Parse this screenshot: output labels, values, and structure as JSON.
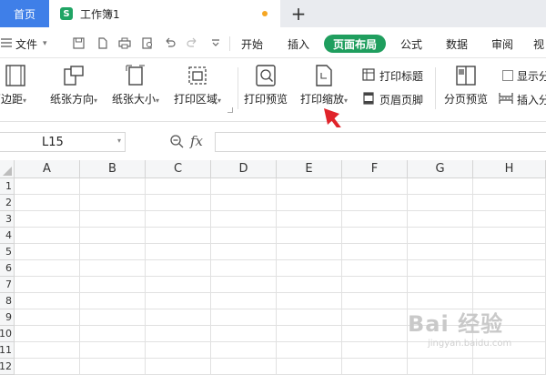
{
  "tabs": {
    "home": "首页",
    "document": "工作簿1",
    "new_tab": "+"
  },
  "menu": {
    "file": "文件",
    "items": [
      "开始",
      "插入",
      "页面布局",
      "公式",
      "数据",
      "审阅",
      "视"
    ],
    "active": "页面布局"
  },
  "ribbon": {
    "margins": "页边距",
    "orientation": "纸张方向",
    "paper_size": "纸张大小",
    "print_area": "打印区域",
    "print_preview": "打印预览",
    "print_scale": "打印缩放",
    "print_titles": "打印标题",
    "header_footer": "页眉页脚",
    "page_break_preview": "分页预览",
    "show_page_breaks": "显示分",
    "insert_page_break": "插入分"
  },
  "formula_bar": {
    "name_box": "L15",
    "fx": "fx",
    "value": ""
  },
  "grid": {
    "columns": [
      "A",
      "B",
      "C",
      "D",
      "E",
      "F",
      "G",
      "H"
    ],
    "rows": [
      "1",
      "2",
      "3",
      "4",
      "5",
      "6",
      "7",
      "8",
      "9",
      "10",
      "11",
      "12"
    ]
  },
  "watermark": {
    "text": "Bai 经验",
    "sub": "jingyan.baidu.com"
  },
  "colors": {
    "accent": "#1f9e5e",
    "home_tab": "#3f7fe8",
    "arrow": "#e0232a"
  }
}
